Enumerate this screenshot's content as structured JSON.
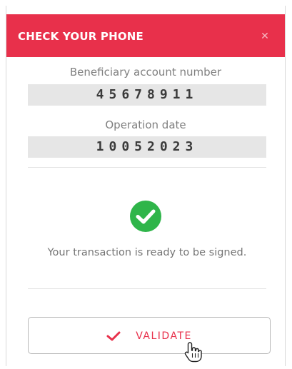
{
  "dialog": {
    "title": "CHECK YOUR PHONE",
    "close_symbol": "✕",
    "fields": [
      {
        "label": "Beneficiary account number",
        "value": "45678911"
      },
      {
        "label": "Operation date",
        "value": "10052023"
      }
    ],
    "status_icon": "check-circle-icon",
    "message": "Your transaction is ready to be signed.",
    "validate_label": "VALIDATE"
  },
  "colors": {
    "accent": "#e8304b",
    "success": "#2fb54a",
    "field_bg": "#e6e6e6"
  }
}
